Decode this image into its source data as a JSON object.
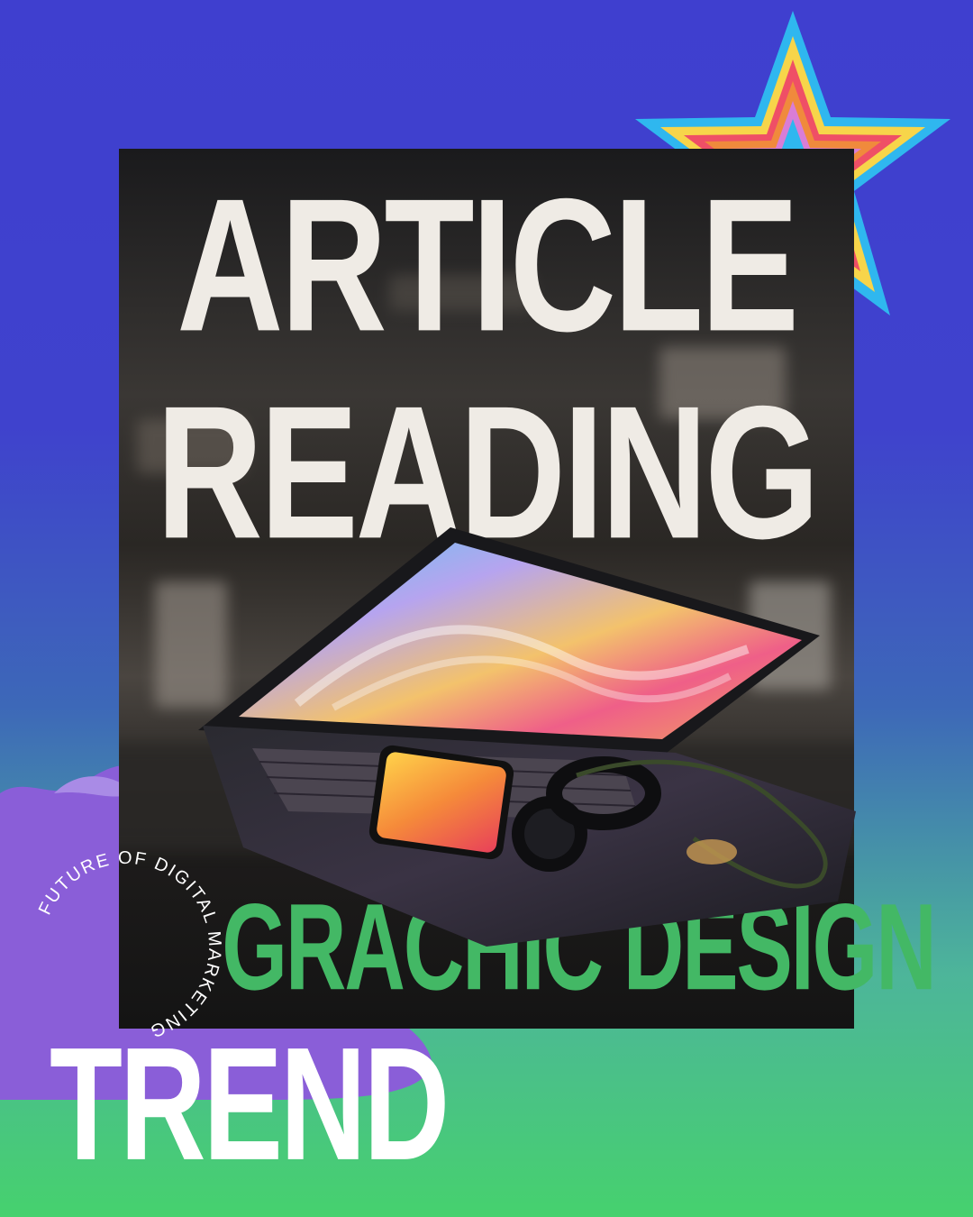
{
  "poster": {
    "headline_line1": "ARTICLE",
    "headline_line2": "READING",
    "subtitle": "GRACHIC DESIGN",
    "circular_text": "FUTURE OF DIGITAL MARKETING",
    "bottom_word": "TREND"
  },
  "colors": {
    "background_top": "#3f3fcf",
    "background_bottom": "#46d16e",
    "headline": "#efebe5",
    "subtitle": "#43b865",
    "blob": "#8a5ed8",
    "star_rings": [
      "#2fb7ef",
      "#f7d54a",
      "#ef4f66",
      "#f08a3c",
      "#d97dd6"
    ]
  },
  "icons": {
    "star": "rainbow-star-icon",
    "laptop": "laptop-photo"
  }
}
